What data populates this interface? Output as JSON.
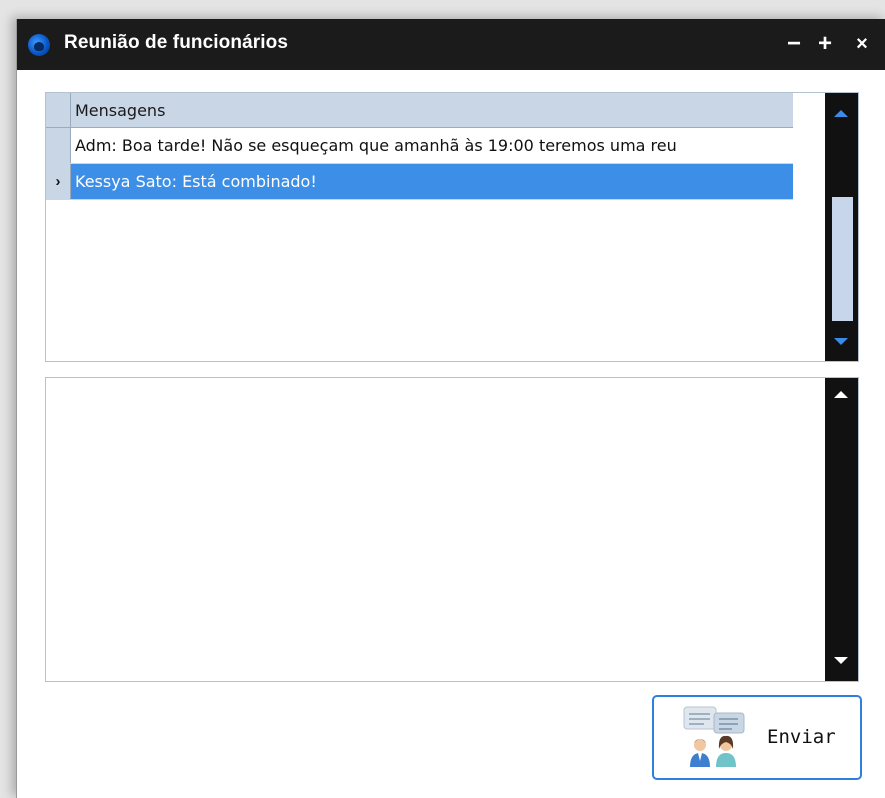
{
  "window": {
    "title": "Reunião de funcionários",
    "controls": {
      "minimize": "−",
      "maximize": "+",
      "close": "×"
    }
  },
  "grid": {
    "column_header": "Mensagens",
    "rows": [
      {
        "indicator": "",
        "text": "Adm: Boa tarde! Não se esqueçam que amanhã às 19:00 teremos uma reu"
      },
      {
        "indicator": "›",
        "text": "Kessya Sato: Está combinado!",
        "selected": true
      }
    ]
  },
  "message_input": {
    "value": ""
  },
  "send_button": {
    "label": "Enviar",
    "icon": "chat-people-icon"
  },
  "colors": {
    "titlebar": "#1b1b1b",
    "selection": "#3d8ee6",
    "accent": "#2f7fdc",
    "header": "#c9d6e6"
  }
}
